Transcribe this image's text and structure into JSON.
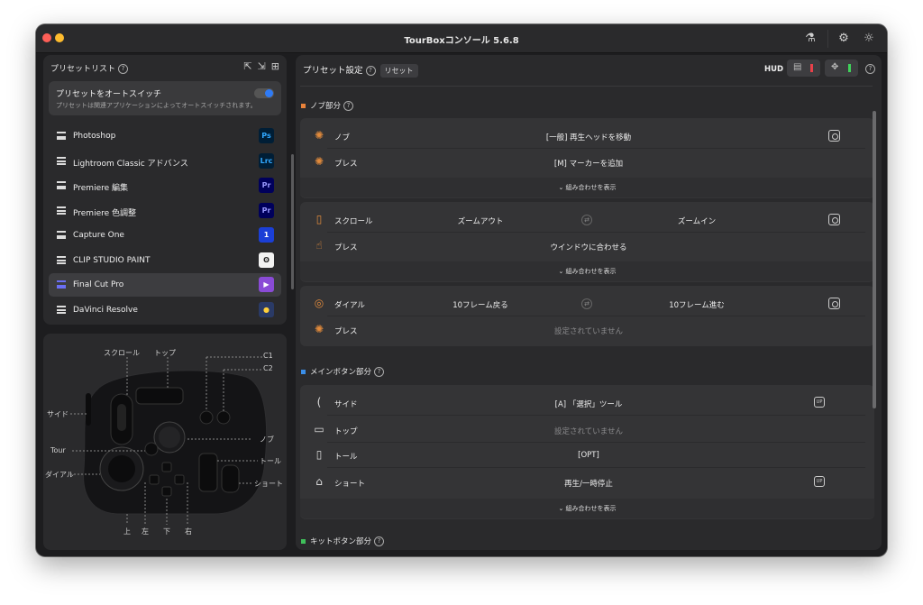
{
  "window": {
    "title": "TourBoxコンソール 5.6.8"
  },
  "presets": {
    "header": "プリセットリスト",
    "auto_switch": {
      "title": "プリセットをオートスイッチ",
      "desc": "プリセットは関連アプリケーションによってオートスイッチされます。",
      "enabled": true
    },
    "items": [
      {
        "name": "Photoshop",
        "badge": "Ps",
        "badge_color": "#31a8ff",
        "badge_bg": "#001e36"
      },
      {
        "name": "Lightroom Classic アドバンス",
        "badge": "Lrc",
        "badge_color": "#31a8ff",
        "badge_bg": "#001e36"
      },
      {
        "name": "Premiere 編集",
        "badge": "Pr",
        "badge_color": "#9999ff",
        "badge_bg": "#00005b"
      },
      {
        "name": "Premiere 色調整",
        "badge": "Pr",
        "badge_color": "#9999ff",
        "badge_bg": "#00005b"
      },
      {
        "name": "Capture One",
        "badge": "1",
        "badge_color": "#ffffff",
        "badge_bg": "#1b3fd6"
      },
      {
        "name": "CLIP STUDIO PAINT",
        "badge": "ʘ",
        "badge_color": "#222222",
        "badge_bg": "#f2f2f2"
      },
      {
        "name": "Final Cut Pro",
        "badge": "▶",
        "badge_color": "#ffffff",
        "badge_bg": "#8a4bd6"
      },
      {
        "name": "DaVinci Resolve",
        "badge": "●",
        "badge_color": "#ffcf3a",
        "badge_bg": "#2a3a66"
      }
    ],
    "selected": "Final Cut Pro"
  },
  "device_labels": {
    "scroll": "スクロール",
    "top": "トップ",
    "c1": "C1",
    "c2": "C2",
    "side": "サイド",
    "knob": "ノブ",
    "tour": "Tour",
    "tall": "トール",
    "dial": "ダイアル",
    "short": "ショート",
    "up": "上",
    "left": "左",
    "down": "下",
    "right": "右"
  },
  "settings": {
    "header": "プリセット設定",
    "reset": "リセット",
    "hud": "HUD",
    "knob_section": "ノブ部分",
    "main_section": "メインボタン部分",
    "kit_section": "キットボタン部分",
    "show_combos": "組み合わせを表示",
    "knob_card": [
      {
        "label": "ノブ",
        "value": "[一般] 再生ヘッドを移動"
      },
      {
        "label": "プレス",
        "value": "[M] マーカーを追加"
      }
    ],
    "scroll_card": [
      {
        "label": "スクロール",
        "left": "ズームアウト",
        "right": "ズームイン"
      },
      {
        "label": "プレス",
        "value": "ウインドウに合わせる"
      }
    ],
    "dial_card": [
      {
        "label": "ダイアル",
        "left": "10フレーム戻る",
        "right": "10フレーム進む"
      },
      {
        "label": "プレス",
        "value": "設定されていません"
      }
    ],
    "main_card": [
      {
        "label": "サイド",
        "value": "[A] 「選択」ツール"
      },
      {
        "label": "トップ",
        "value": "設定されていません"
      },
      {
        "label": "トール",
        "value": "[OPT]"
      },
      {
        "label": "ショート",
        "value": "再生/一時停止"
      }
    ]
  },
  "colors": {
    "knob_section": "#e8823a",
    "main_section": "#3a8ee8",
    "kit_section": "#3fbf5a",
    "hud_red": "#e8414a",
    "hud_green": "#3fd15a"
  }
}
